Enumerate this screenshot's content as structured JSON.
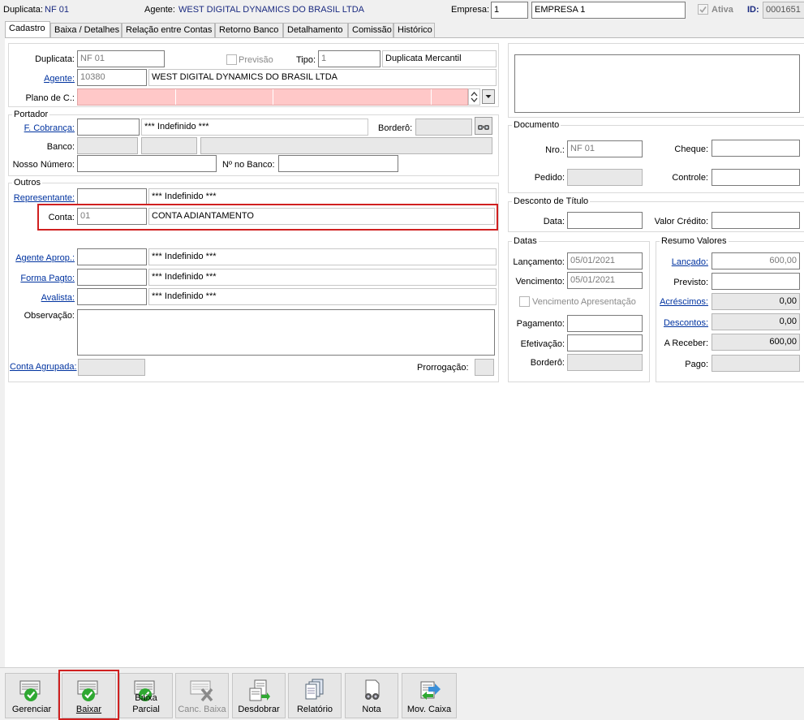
{
  "header": {
    "duplicata_label": "Duplicata:",
    "duplicata_value": "NF 01",
    "agente_label": "Agente:",
    "agente_value": "WEST DIGITAL DYNAMICS DO BRASIL LTDA",
    "empresa_label": "Empresa:",
    "empresa_code": "1",
    "empresa_name": "EMPRESA 1",
    "ativa_label": "Ativa",
    "id_label": "ID:",
    "id_value": "0001651"
  },
  "tabs": [
    {
      "label": "Cadastro"
    },
    {
      "label": "Baixa / Detalhes"
    },
    {
      "label": "Relação entre Contas"
    },
    {
      "label": "Retorno Banco"
    },
    {
      "label": "Detalhamento"
    },
    {
      "label": "Comissão"
    },
    {
      "label": "Histórico"
    }
  ],
  "cadastro": {
    "duplicata_label": "Duplicata:",
    "duplicata_value": "NF 01",
    "previsao_label": "Previsão",
    "tipo_label": "Tipo:",
    "tipo_code": "1",
    "tipo_name": "Duplicata Mercantil",
    "agente_label": "Agente:",
    "agente_code": "10380",
    "agente_name": "WEST DIGITAL DYNAMICS DO BRASIL LTDA",
    "plano_label": "Plano de C.:"
  },
  "portador": {
    "title": "Portador",
    "cobranca_label": "F. Cobrança:",
    "cobranca_name": "*** Indefinido ***",
    "bordero_label": "Borderô:",
    "banco_label": "Banco:",
    "nosso_numero_label": "Nosso Número:",
    "no_banco_label": "Nº no Banco:"
  },
  "outros": {
    "title": "Outros",
    "representante_label": "Representante:",
    "representante_name": "*** Indefinido ***",
    "conta_label": "Conta:",
    "conta_code": "01",
    "conta_name": "CONTA ADIANTAMENTO",
    "agente_aprop_label": "Agente Aprop.:",
    "agente_aprop_name": "*** Indefinido ***",
    "forma_pagto_label": "Forma Pagto:",
    "forma_pagto_name": "*** Indefinido ***",
    "avalista_label": "Avalista:",
    "avalista_name": "*** Indefinido ***",
    "observacao_label": "Observação:",
    "conta_agrupada_label": "Conta Agrupada:",
    "prorrogacao_label": "Prorrogação:"
  },
  "documento": {
    "title": "Documento",
    "nro_label": "Nro.:",
    "nro_value": "NF 01",
    "cheque_label": "Cheque:",
    "pedido_label": "Pedido:",
    "controle_label": "Controle:"
  },
  "desconto": {
    "title": "Desconto de Título",
    "data_label": "Data:",
    "valor_credito_label": "Valor Crédito:"
  },
  "datas": {
    "title": "Datas",
    "lancamento_label": "Lançamento:",
    "lancamento_value": "05/01/2021",
    "vencimento_label": "Vencimento:",
    "vencimento_value": "05/01/2021",
    "venc_apresentacao_label": "Vencimento Apresentação",
    "pagamento_label": "Pagamento:",
    "efetivacao_label": "Efetivação:",
    "bordero_label": "Borderô:"
  },
  "resumo": {
    "title": "Resumo Valores",
    "lancado_label": "Lançado:",
    "lancado_value": "600,00",
    "previsto_label": "Previsto:",
    "acrescimos_label": "Acréscimos:",
    "acrescimos_value": "0,00",
    "descontos_label": "Descontos:",
    "descontos_value": "0,00",
    "a_receber_label": "A Receber:",
    "a_receber_value": "600,00",
    "pago_label": "Pago:"
  },
  "toolbar": {
    "gerenciar": "Gerenciar",
    "baixar": "Baixar",
    "baixa_parcial": "Baixa Parcial",
    "canc_baixa": "Canc. Baixa",
    "desdobrar": "Desdobrar",
    "relatorio": "Relatório",
    "nota": "Nota",
    "mov_caixa": "Mov. Caixa"
  },
  "colors": {
    "link": "#0033a0",
    "highlight": "#d02020",
    "required_field": "#ffc8c8",
    "check_green": "#2fa832"
  }
}
